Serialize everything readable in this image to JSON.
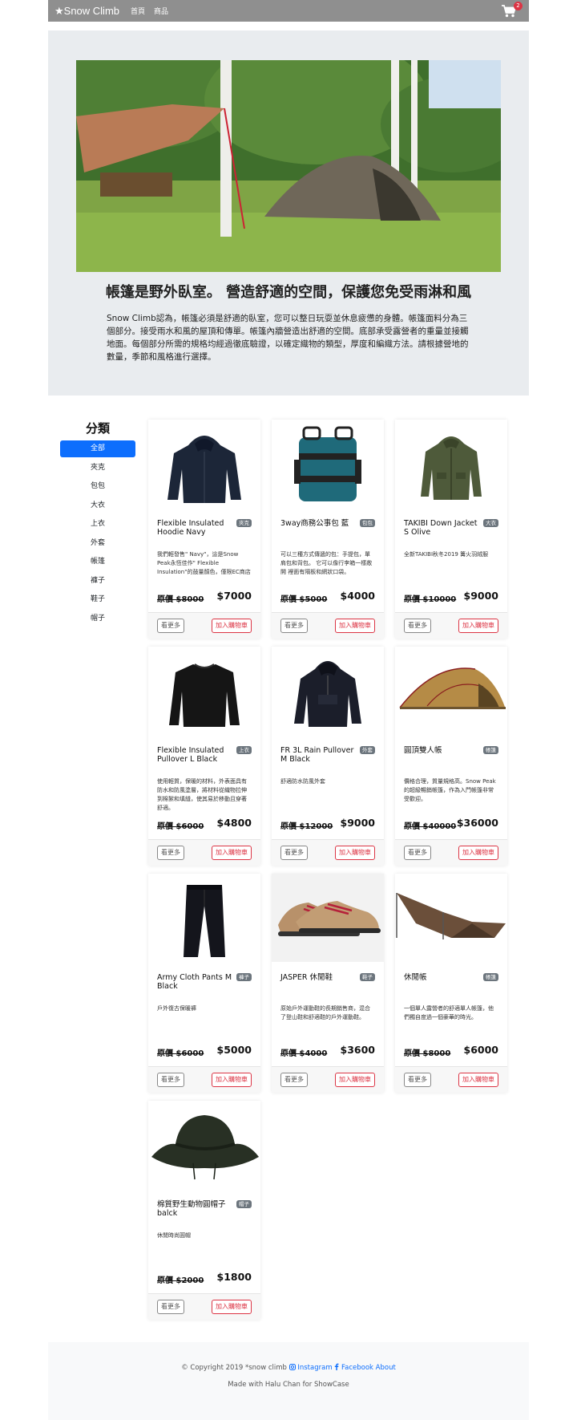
{
  "navbar": {
    "brand": "★Snow Climb",
    "links": [
      "首頁",
      "商品"
    ],
    "cart_count": "2"
  },
  "hero": {
    "title": "帳篷是野外臥室。 營造舒適的空間，保護您免受雨淋和風",
    "text": "Snow Climb認為，帳篷必須是舒適的臥室，您可以整日玩耍並休息疲憊的身體。帳篷面料分為三個部分。接受雨水和風的屋頂和傳單。帳篷內牆營造出舒適的空間。底部承受露營者的重量並接觸地面。每個部分所需的規格均經過徹底驗證，以確定織物的類型，厚度和編織方法。請根據營地的數量，季節和風格進行選擇。"
  },
  "sidebar": {
    "title": "分類",
    "categories": [
      "全部",
      "夾克",
      "包包",
      "大衣",
      "上衣",
      "外套",
      "帳篷",
      "褲子",
      "鞋子",
      "帽子"
    ]
  },
  "buttons": {
    "more": "看更多",
    "add_cart": "加入購物車"
  },
  "products": [
    {
      "name": "Flexible Insulated Hoodie Navy",
      "badge": "夾克",
      "desc": "我們輕發售\" Navy\"，這是Snow Peak永恆佳作\" Flexible Insulation\"的鼓量顏色，僅限EC商店",
      "orig_label": "原價",
      "orig_price": "$8000",
      "price": "$7000",
      "icon": "hoodie-icon"
    },
    {
      "name": "3way商務公事包 藍",
      "badge": "包包",
      "desc": "可以三種方式傳遞的包：手提包，單肩包和背包。 它可以像行李箱一樣敞開 裡面有隔板和網狀口袋。",
      "orig_label": "原價",
      "orig_price": "$5000",
      "price": "$4000",
      "icon": "backpack-icon"
    },
    {
      "name": "TAKIBI Down Jacket S Olive",
      "badge": "大衣",
      "desc": "全新TAKIBI秋冬2019 篝火羽絨服",
      "orig_label": "原價",
      "orig_price": "$10000",
      "price": "$9000",
      "icon": "jacket-icon"
    },
    {
      "name": "Flexible Insulated Pullover L Black",
      "badge": "上衣",
      "desc": "使用輕質，保暖的材料，外表面具有防水和防風塗層，將材料從織物拉伸到棉絮和填縫，使其易於移動且穿著舒適。",
      "orig_label": "原價",
      "orig_price": "$6000",
      "price": "$4800",
      "icon": "pullover-icon"
    },
    {
      "name": "FR 3L Rain Pullover M Black",
      "badge": "外套",
      "desc": "舒適防水防風外套",
      "orig_label": "原價",
      "orig_price": "$12000",
      "price": "$9000",
      "icon": "rain-jacket-icon"
    },
    {
      "name": "圓頂雙人帳",
      "badge": "帳篷",
      "desc": "價格合理，質量規格高。Snow Peak的超級暢銷帳篷，作為入門帳篷非常受歡迎。",
      "orig_label": "原價",
      "orig_price": "$40000",
      "price": "$36000",
      "icon": "dome-tent-icon"
    },
    {
      "name": "Army Cloth Pants M Black",
      "badge": "褲子",
      "desc": "戶外復古保暖褲",
      "orig_label": "原價",
      "orig_price": "$6000",
      "price": "$5000",
      "icon": "pants-icon"
    },
    {
      "name": "JASPER 休閒鞋",
      "badge": "鞋子",
      "desc": "原始戶外運動鞋的長期銷售商，混合了登山鞋和舒適鞋的戶外運動鞋。",
      "orig_label": "原價",
      "orig_price": "$4000",
      "price": "$3600",
      "icon": "shoe-icon"
    },
    {
      "name": "休閒帳",
      "badge": "帳篷",
      "desc": "一個單人露營者的舒適單人帳篷，他們獨自度過一個豪華的時光。",
      "orig_label": "原價",
      "orig_price": "$8000",
      "price": "$6000",
      "icon": "tarp-tent-icon"
    },
    {
      "name": "棉質野生動物圓帽子 balck",
      "badge": "帽子",
      "desc": "休閒時尚圓帽",
      "orig_label": "原價",
      "orig_price": "$2000",
      "price": "$1800",
      "icon": "hat-icon"
    }
  ],
  "footer": {
    "copyright": "© Copyright 2019 *snow climb",
    "instagram": "Instagram",
    "facebook": "Facebook",
    "about": "About",
    "made_with": "Made with Halu Chan for ShowCase"
  }
}
